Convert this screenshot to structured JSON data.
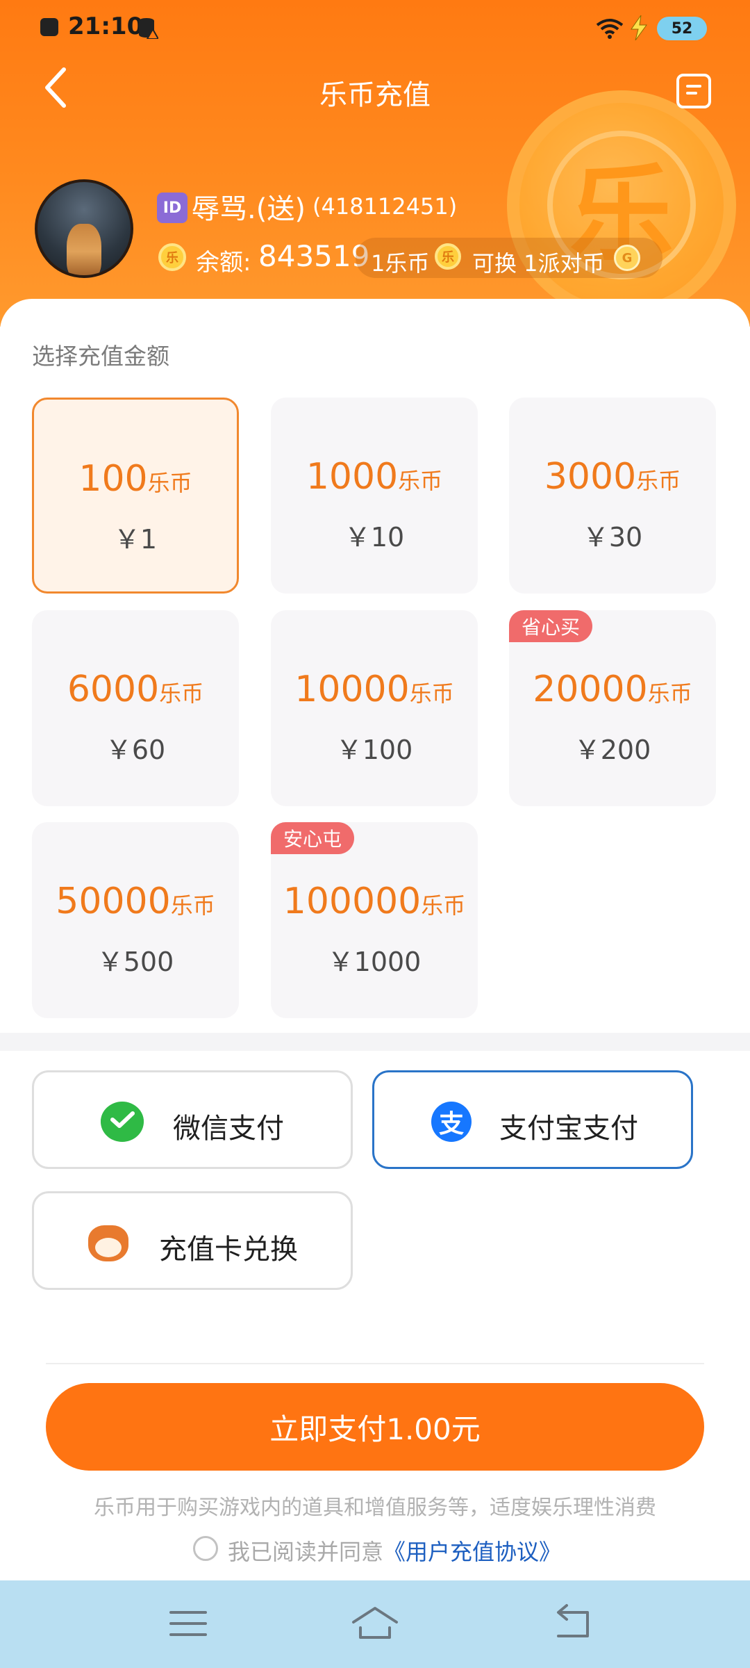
{
  "status_bar": {
    "time": "21:10",
    "battery": "52"
  },
  "header": {
    "title": "乐币充值",
    "big_coin_glyph": "乐",
    "user": {
      "id_badge": "ID",
      "name": "辱骂.(送)",
      "id": "(418112451)",
      "balance_label": "余额:",
      "balance_value": "843519",
      "coin_glyph": "乐",
      "rate_text_1": "1乐币",
      "rate_text_2": "可换 1派对币",
      "party_coin_glyph": "G"
    }
  },
  "recharge": {
    "section_label": "选择充值金额",
    "options": [
      {
        "amount": "100",
        "unit": "乐币",
        "price": "￥1",
        "tag": "",
        "selected": true
      },
      {
        "amount": "1000",
        "unit": "乐币",
        "price": "￥10",
        "tag": "",
        "selected": false
      },
      {
        "amount": "3000",
        "unit": "乐币",
        "price": "￥30",
        "tag": "",
        "selected": false
      },
      {
        "amount": "6000",
        "unit": "乐币",
        "price": "￥60",
        "tag": "",
        "selected": false
      },
      {
        "amount": "10000",
        "unit": "乐币",
        "price": "￥100",
        "tag": "",
        "selected": false
      },
      {
        "amount": "20000",
        "unit": "乐币",
        "price": "￥200",
        "tag": "省心买",
        "selected": false
      },
      {
        "amount": "50000",
        "unit": "乐币",
        "price": "￥500",
        "tag": "",
        "selected": false
      },
      {
        "amount": "100000",
        "unit": "乐币",
        "price": "￥1000",
        "tag": "安心屯",
        "selected": false
      }
    ]
  },
  "payment": {
    "wechat_label": "微信支付",
    "alipay_label": "支付宝支付",
    "alipay_glyph": "支",
    "card_label": "充值卡兑换",
    "selected": "alipay"
  },
  "footer": {
    "pay_button": "立即支付1.00元",
    "notice": "乐币用于购买游戏内的道具和增值服务等，适度娱乐理性消费",
    "agree_text": "我已阅读并同意",
    "agreement_link": "《用户充值协议》"
  },
  "colors": {
    "header_orange": "#ff7a12",
    "accent_orange": "#f07a1c",
    "pay_button": "#ff7412",
    "selected_border_blue": "#2a74c8",
    "link_blue": "#1d5fc0",
    "nav_bar": "#b9dff2"
  },
  "icons": {
    "back": "chevron-left-icon",
    "menu": "list-menu-icon",
    "wechat": "wechat-pay-icon",
    "alipay": "alipay-icon",
    "card": "tiger-mascot-icon",
    "nav_menu": "hamburger-icon",
    "nav_home": "home-icon",
    "nav_back": "return-icon"
  }
}
